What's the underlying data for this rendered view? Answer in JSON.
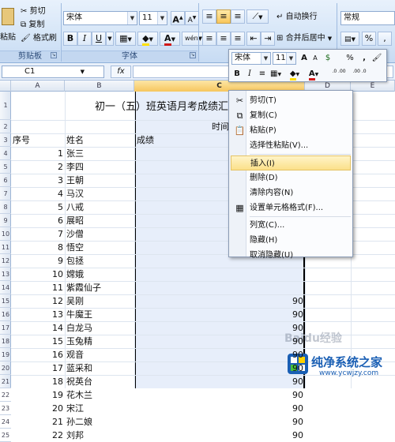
{
  "ribbon": {
    "clipboard": {
      "paste": "粘贴",
      "cut": "剪切",
      "copy": "复制",
      "format_painter": "格式刷",
      "group": "剪贴板"
    },
    "font": {
      "name": "宋体",
      "size": "11",
      "grow": "A",
      "shrink": "A",
      "bold": "B",
      "italic": "I",
      "underline": "U",
      "font_color": "A",
      "phonetic": "wén",
      "group": "字体"
    },
    "alignment": {
      "wrap_text": "自动换行",
      "merge_center": "合并后居中"
    },
    "number": {
      "format": "常规",
      "percent": "%",
      "comma": ","
    }
  },
  "formula_bar": {
    "name_box": "C1",
    "fx": "fx",
    "content": ""
  },
  "columns": [
    "A",
    "B",
    "C",
    "D",
    "E"
  ],
  "rows": [
    "1",
    "2",
    "3",
    "4",
    "5",
    "6",
    "7",
    "8",
    "9",
    "10",
    "11",
    "12",
    "13",
    "14",
    "15",
    "16",
    "17",
    "18",
    "19",
    "20",
    "21",
    "22",
    "23",
    "24",
    "25"
  ],
  "sheet": {
    "title": "初一（五）班英语月考成绩汇总",
    "time_label": "时间",
    "header_seq": "序号",
    "header_name": "姓名",
    "header_score": "成绩",
    "records": [
      {
        "n": "1",
        "name": "张三",
        "score": ""
      },
      {
        "n": "2",
        "name": "李四",
        "score": ""
      },
      {
        "n": "3",
        "name": "王朝",
        "score": ""
      },
      {
        "n": "4",
        "name": "马汉",
        "score": ""
      },
      {
        "n": "5",
        "name": "八戒",
        "score": ""
      },
      {
        "n": "6",
        "name": "展昭",
        "score": ""
      },
      {
        "n": "7",
        "name": "沙僧",
        "score": ""
      },
      {
        "n": "8",
        "name": "悟空",
        "score": ""
      },
      {
        "n": "9",
        "name": "包拯",
        "score": ""
      },
      {
        "n": "10",
        "name": "嫦娥",
        "score": ""
      },
      {
        "n": "11",
        "name": "紫霞仙子",
        "score": ""
      },
      {
        "n": "12",
        "name": "吴刚",
        "score": "90"
      },
      {
        "n": "13",
        "name": "牛魔王",
        "score": "90"
      },
      {
        "n": "14",
        "name": "白龙马",
        "score": "90"
      },
      {
        "n": "15",
        "name": "玉兔精",
        "score": "90"
      },
      {
        "n": "16",
        "name": "观音",
        "score": "90"
      },
      {
        "n": "17",
        "name": "蓝采和",
        "score": "90"
      },
      {
        "n": "18",
        "name": "祝英台",
        "score": "90"
      },
      {
        "n": "19",
        "name": "花木兰",
        "score": "90"
      },
      {
        "n": "20",
        "name": "宋江",
        "score": "90"
      },
      {
        "n": "21",
        "name": "孙二娘",
        "score": "90"
      },
      {
        "n": "22",
        "name": "刘邦",
        "score": "90"
      }
    ]
  },
  "mini_toolbar": {
    "font": "宋体",
    "size": "11",
    "grow": "A",
    "shrink": "A",
    "currency": "$",
    "percent": "%",
    "comma": ",",
    "bold": "B",
    "italic": "I",
    "font_color": "A",
    "inc_decimal": ".0 .00",
    "dec_decimal": ".00 .0"
  },
  "context_menu": [
    {
      "label": "剪切(T)",
      "icon": "scissors-icon",
      "glyph": "✂",
      "hl": false
    },
    {
      "label": "复制(C)",
      "icon": "copy-icon",
      "glyph": "⧉",
      "hl": false
    },
    {
      "label": "粘贴(P)",
      "icon": "paste-icon",
      "glyph": "📋",
      "hl": false
    },
    {
      "label": "选择性粘贴(V)...",
      "icon": "",
      "glyph": "",
      "hl": false
    },
    {
      "label": "插入(I)",
      "icon": "",
      "glyph": "",
      "hl": true
    },
    {
      "label": "删除(D)",
      "icon": "",
      "glyph": "",
      "hl": false
    },
    {
      "label": "清除内容(N)",
      "icon": "",
      "glyph": "",
      "hl": false
    },
    {
      "label": "设置单元格格式(F)...",
      "icon": "format-cells-icon",
      "glyph": "▦",
      "hl": false
    },
    {
      "label": "列宽(C)...",
      "icon": "",
      "glyph": "",
      "hl": false
    },
    {
      "label": "隐藏(H)",
      "icon": "",
      "glyph": "",
      "hl": false
    },
    {
      "label": "取消隐藏(U)",
      "icon": "",
      "glyph": "",
      "hl": false
    }
  ],
  "watermark": {
    "baidu": "Baidu经验",
    "brand": "纯净系统之家",
    "url": "www.ycwjzy.com"
  },
  "colors": {
    "ribbon_bg": "#d5e5f7",
    "menu_highlight": "#fbe08a",
    "selected_col": "#e7eefa",
    "brand_blue": "#1a5fb4"
  }
}
